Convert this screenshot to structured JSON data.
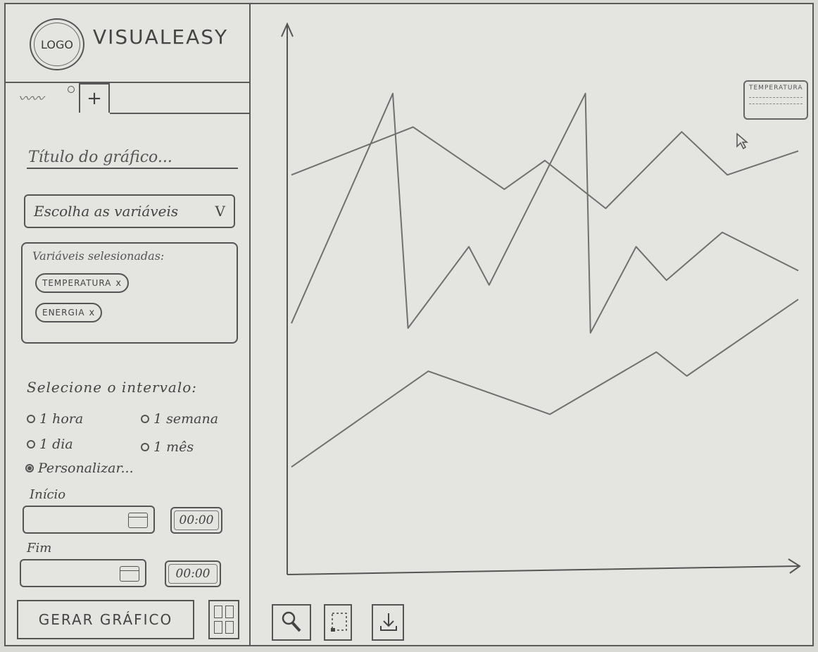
{
  "header": {
    "logo_text": "LOGO",
    "app_name": "VISUALEASY"
  },
  "tabs": {
    "active_icon": "scribble-tab",
    "add_label": "+"
  },
  "form": {
    "title_placeholder": "Título do gráfico...",
    "variables_select": {
      "label": "Escolha as variáveis",
      "chevron": "V"
    },
    "selected_label": "Variáveis selesionadas:",
    "selected_chips": [
      {
        "label": "TEMPERATURA",
        "remove": "x"
      },
      {
        "label": "ENERGIA",
        "remove": "x"
      }
    ],
    "interval_label": "Selecione o intervalo:",
    "interval_options": [
      {
        "label": "1 hora",
        "selected": false
      },
      {
        "label": "1 semana",
        "selected": false
      },
      {
        "label": "1 dia",
        "selected": false
      },
      {
        "label": "1 mês",
        "selected": false
      },
      {
        "label": "Personalizar...",
        "selected": true
      }
    ],
    "start": {
      "label": "Início",
      "time": "00:00"
    },
    "end": {
      "label": "Fim",
      "time": "00:00"
    },
    "generate_label": "GERAR GRÁFICO"
  },
  "tooltip": {
    "title": "TEMPERATURA"
  },
  "toolbar": {
    "tools": [
      "zoom-tool",
      "select-area-tool",
      "download-tool"
    ]
  },
  "colors": {
    "line": "#707070",
    "border": "#555555",
    "paper": "#e4e4e1"
  },
  "chart_data": {
    "type": "line",
    "title": "",
    "xlabel": "",
    "ylabel": "",
    "xlim": [
      0,
      100
    ],
    "ylim": [
      0,
      100
    ],
    "series": [
      {
        "x": [
          0,
          24,
          42,
          50,
          62,
          77,
          86,
          100
        ],
        "y": [
          82,
          92,
          79,
          85,
          75,
          91,
          82,
          87
        ]
      },
      {
        "x": [
          0,
          20,
          23,
          35,
          39,
          58,
          59,
          68,
          74,
          85,
          100
        ],
        "y": [
          51,
          99,
          50,
          67,
          59,
          99,
          49,
          67,
          60,
          70,
          62
        ]
      },
      {
        "x": [
          0,
          27,
          51,
          72,
          78,
          100
        ],
        "y": [
          21,
          41,
          32,
          45,
          40,
          56
        ]
      }
    ]
  }
}
